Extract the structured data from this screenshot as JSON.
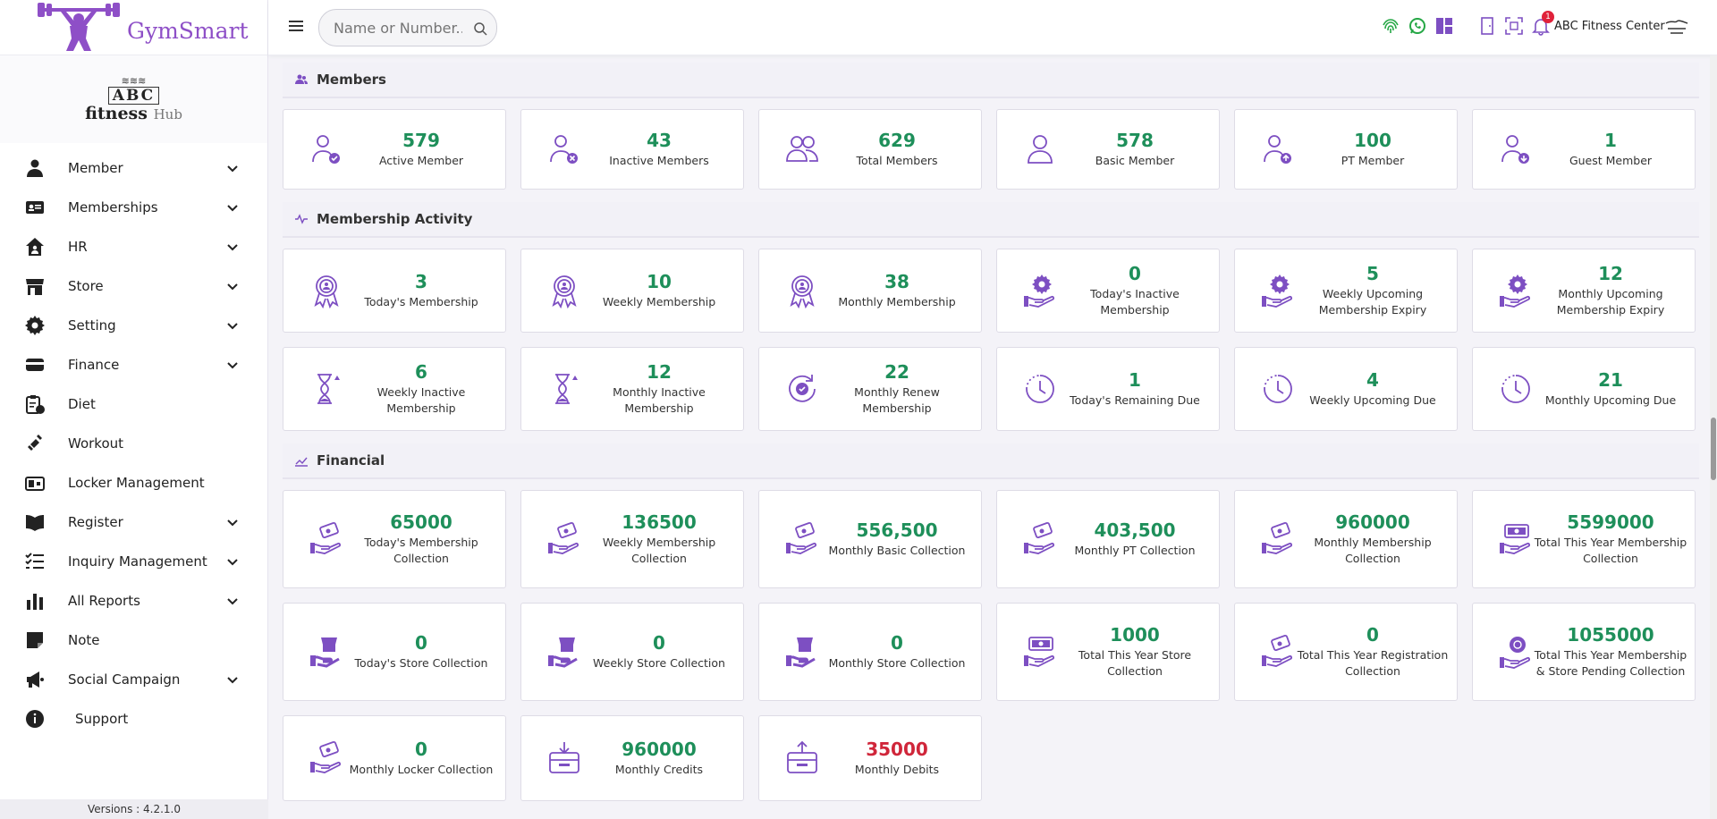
{
  "brand": {
    "name": "GymSmart",
    "logo_line1": "ABC",
    "logo_line2": "fitness",
    "logo_line3": "Hub"
  },
  "sidebar": {
    "items": [
      {
        "label": "Member",
        "icon": "user-icon",
        "chevron": true
      },
      {
        "label": "Memberships",
        "icon": "id-card-icon",
        "chevron": true
      },
      {
        "label": "HR",
        "icon": "house-user-icon",
        "chevron": true
      },
      {
        "label": "Store",
        "icon": "store-icon",
        "chevron": true
      },
      {
        "label": "Setting",
        "icon": "gear-icon",
        "chevron": true
      },
      {
        "label": "Finance",
        "icon": "credit-card-icon",
        "chevron": true
      },
      {
        "label": "Diet",
        "icon": "clipboard-clock-icon",
        "chevron": false
      },
      {
        "label": "Workout",
        "icon": "dumbbell-icon",
        "chevron": false
      },
      {
        "label": "Locker Management",
        "icon": "locker-icon",
        "chevron": false
      },
      {
        "label": "Register",
        "icon": "book-icon",
        "chevron": true
      },
      {
        "label": "Inquiry Management",
        "icon": "list-check-icon",
        "chevron": true
      },
      {
        "label": "All Reports",
        "icon": "bar-chart-icon",
        "chevron": true
      },
      {
        "label": "Note",
        "icon": "note-icon",
        "chevron": false
      },
      {
        "label": "Social Campaign",
        "icon": "megaphone-icon",
        "chevron": true
      },
      {
        "label": "Support",
        "icon": "info-icon",
        "chevron": false
      }
    ],
    "version": "Versions : 4.2.1.0"
  },
  "topbar": {
    "search_placeholder": "Name or Number...",
    "notification_count": "1",
    "center_name": "ABC Fitness Center"
  },
  "sections": {
    "members": {
      "title": "Members",
      "cards": [
        {
          "value": "579",
          "label": "Active Member",
          "icon": "user-check-icon"
        },
        {
          "value": "43",
          "label": "Inactive Members",
          "icon": "user-x-icon"
        },
        {
          "value": "629",
          "label": "Total Members",
          "icon": "users-icon"
        },
        {
          "value": "578",
          "label": "Basic Member",
          "icon": "user-icon"
        },
        {
          "value": "100",
          "label": "PT Member",
          "icon": "user-up-icon"
        },
        {
          "value": "1",
          "label": "Guest Member",
          "icon": "user-down-icon"
        }
      ]
    },
    "activity": {
      "title": "Membership Activity",
      "cards": [
        {
          "value": "3",
          "label": "Today's Membership",
          "icon": "badge-icon"
        },
        {
          "value": "10",
          "label": "Weekly Membership",
          "icon": "badge-icon"
        },
        {
          "value": "38",
          "label": "Monthly Membership",
          "icon": "badge-icon"
        },
        {
          "value": "0",
          "label": "Today's Inactive Membership",
          "icon": "hand-gear-icon"
        },
        {
          "value": "5",
          "label": "Weekly Upcoming Membership Expiry",
          "icon": "hand-gear-icon"
        },
        {
          "value": "12",
          "label": "Monthly Upcoming Membership Expiry",
          "icon": "hand-gear-icon"
        },
        {
          "value": "6",
          "label": "Weekly Inactive Membership",
          "icon": "hourglass-icon"
        },
        {
          "value": "12",
          "label": "Monthly Inactive Membership",
          "icon": "hourglass-icon"
        },
        {
          "value": "22",
          "label": "Monthly Renew Membership",
          "icon": "renew-icon"
        },
        {
          "value": "1",
          "label": "Today's Remaining Due",
          "icon": "clock-icon"
        },
        {
          "value": "4",
          "label": "Weekly Upcoming Due",
          "icon": "clock-icon"
        },
        {
          "value": "21",
          "label": "Monthly Upcoming Due",
          "icon": "clock-icon"
        }
      ]
    },
    "financial": {
      "title": "Financial",
      "cards": [
        {
          "value": "65000",
          "label": "Today's Membership Collection",
          "icon": "hand-money-icon"
        },
        {
          "value": "136500",
          "label": "Weekly Membership Collection",
          "icon": "hand-money-icon"
        },
        {
          "value": "556,500",
          "label": "Monthly Basic Collection",
          "icon": "hand-money-icon"
        },
        {
          "value": "403,500",
          "label": "Monthly PT Collection",
          "icon": "hand-money-icon"
        },
        {
          "value": "960000",
          "label": "Monthly Membership Collection",
          "icon": "hand-money-icon"
        },
        {
          "value": "5599000",
          "label": "Total This Year Membership Collection",
          "icon": "hand-cash-icon"
        },
        {
          "value": "0",
          "label": "Today's Store Collection",
          "icon": "hand-store-icon"
        },
        {
          "value": "0",
          "label": "Weekly Store Collection",
          "icon": "hand-store-icon"
        },
        {
          "value": "0",
          "label": "Monthly Store Collection",
          "icon": "hand-store-icon"
        },
        {
          "value": "1000",
          "label": "Total This Year Store Collection",
          "icon": "hand-cash-icon"
        },
        {
          "value": "0",
          "label": "Total This Year Registration Collection",
          "icon": "hand-money-icon"
        },
        {
          "value": "1055000",
          "label": "Total This Year Membership & Store Pending Collection",
          "icon": "hand-globe-icon"
        },
        {
          "value": "0",
          "label": "Monthly Locker Collection",
          "icon": "hand-money-icon"
        },
        {
          "value": "960000",
          "label": "Monthly Credits",
          "icon": "wallet-in-icon"
        },
        {
          "value": "35000",
          "label": "Monthly Debits",
          "icon": "wallet-out-icon",
          "negative": true
        }
      ]
    }
  },
  "colors": {
    "accent": "#7d4fc2",
    "value_green": "#1e8f5a",
    "value_red": "#d0263a",
    "whatsapp": "#25a745"
  }
}
